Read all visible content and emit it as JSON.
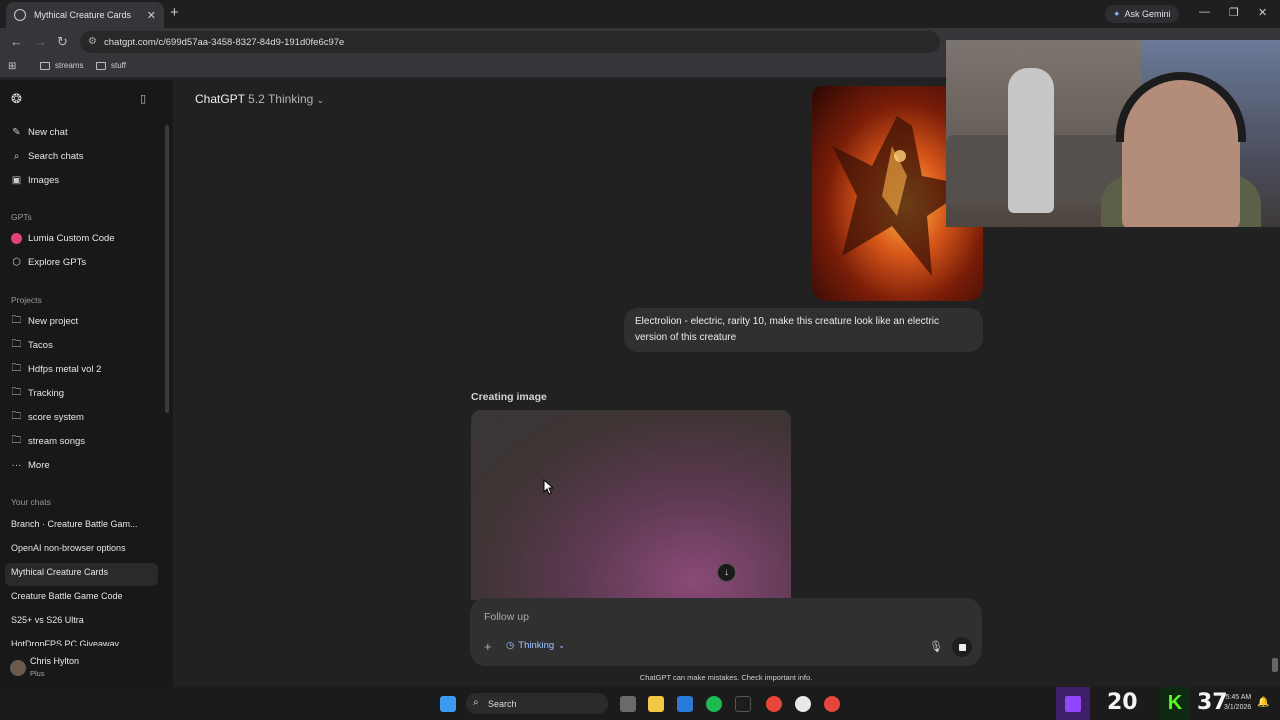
{
  "browser": {
    "tab_title": "Mythical Creature Cards",
    "url": "chatgpt.com/c/699d57aa-3458-8327-84d9-191d0fe6c97e",
    "ask_gemini": "Ask Gemini",
    "bookmarks": [
      "streams",
      "stuff"
    ]
  },
  "sidebar": {
    "top_items": [
      {
        "label": "New chat",
        "icon": "compose-icon"
      },
      {
        "label": "Search chats",
        "icon": "search-icon"
      },
      {
        "label": "Images",
        "icon": "image-icon"
      }
    ],
    "gpts_heading": "GPTs",
    "gpts": [
      {
        "label": "Lumia Custom Code",
        "icon": "gpt-avatar-icon"
      },
      {
        "label": "Explore GPTs",
        "icon": "cube-icon"
      }
    ],
    "projects_heading": "Projects",
    "projects": [
      {
        "label": "New project",
        "icon": "folder-plus-icon"
      },
      {
        "label": "Tacos",
        "icon": "folder-icon"
      },
      {
        "label": "Hdfps metal vol 2",
        "icon": "folder-icon"
      },
      {
        "label": "Tracking",
        "icon": "folder-icon"
      },
      {
        "label": "score system",
        "icon": "folder-icon"
      },
      {
        "label": "stream songs",
        "icon": "folder-icon"
      },
      {
        "label": "More",
        "icon": "more-icon"
      }
    ],
    "chats_heading": "Your chats",
    "chats": [
      "Branch · Creature Battle Gam...",
      "OpenAI non-browser options",
      "Mythical Creature Cards",
      "Creature Battle Game Code",
      "S25+ vs S26 Ultra",
      "HotDropFPS PC Giveaway"
    ],
    "active_chat_index": 2,
    "user": {
      "name": "Chris Hylton",
      "plan": "Plus"
    }
  },
  "main": {
    "model_name": "ChatGPT",
    "model_version": "5.2 Thinking",
    "user_message": "Electrolion - electric, rarity 10, make this creature look like an electric version of this creature",
    "status": "Creating image",
    "composer": {
      "placeholder": "Follow up",
      "mode": "Thinking"
    },
    "disclaimer": "ChatGPT can make mistakes. Check important info."
  },
  "taskbar": {
    "search_label": "Search",
    "overlay_left_num": "20",
    "overlay_right_num": "37",
    "time": "5:45 AM",
    "date": "3/1/2026"
  },
  "colors": {
    "accent_blue": "#9ec5ff",
    "sidebar_bg": "#181818",
    "main_bg": "#212121"
  }
}
